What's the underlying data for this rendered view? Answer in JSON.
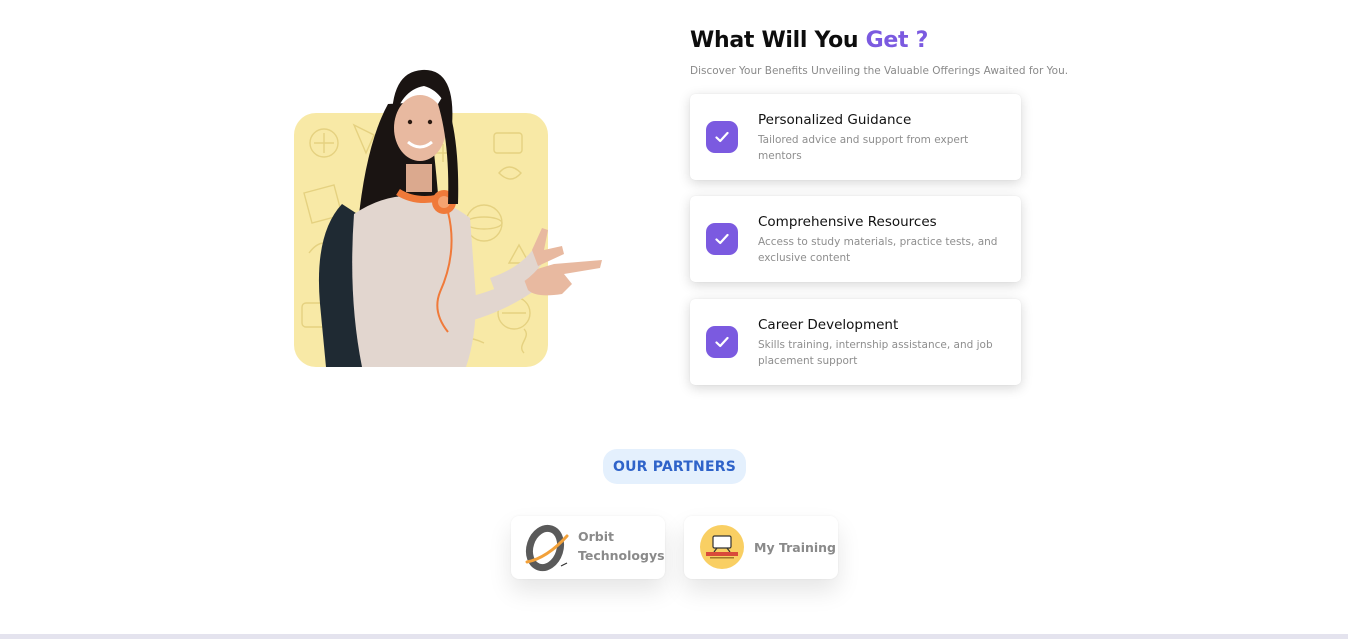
{
  "benefits": {
    "title_main": "What Will You",
    "title_accent": "Get ?",
    "subtitle": "Discover Your Benefits Unveiling the Valuable Offerings Awaited for You.",
    "accent_color": "#7b5ae0",
    "items": [
      {
        "icon": "check-icon",
        "title": "Personalized Guidance",
        "description": "Tailored advice and support from expert mentors"
      },
      {
        "icon": "check-icon",
        "title": "Comprehensive Resources",
        "description": "Access to study materials, practice tests, and exclusive content"
      },
      {
        "icon": "check-icon",
        "title": "Career Development",
        "description": "Skills training, internship assistance, and job placement support"
      }
    ]
  },
  "hero": {
    "image": "student-pointing-illustration",
    "background_color": "#f8e9a6"
  },
  "partners": {
    "heading": "OUR PARTNERS",
    "heading_color": "#2f63c9",
    "items": [
      {
        "name": "Orbit Technologys",
        "logo": "orbit-technologys-logo"
      },
      {
        "name": "My Training",
        "logo": "my-training-logo"
      }
    ]
  }
}
